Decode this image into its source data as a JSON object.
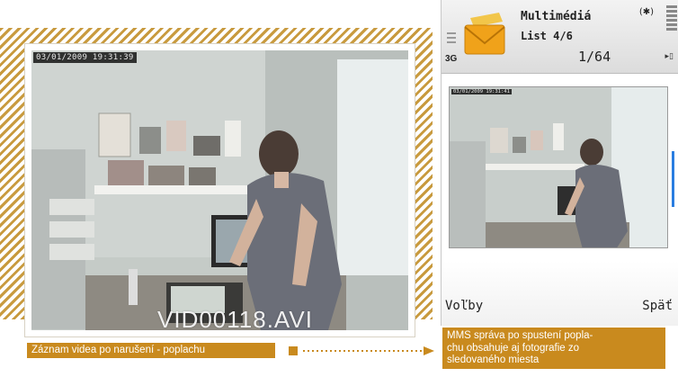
{
  "camera": {
    "timestamp": "03/01/2009 19:31:39",
    "filename": "VID00118.AVI"
  },
  "captions": {
    "left": "Záznam videa po narušení - poplachu",
    "right_line1": "MMS správa po spustení popla-",
    "right_line2": "chu obsahuje aj fotografie zo",
    "right_line3": "sledovaného miesta"
  },
  "phone": {
    "title": "Multimédiá",
    "subtitle": "List 4/6",
    "counter": "1/64",
    "network": "3G",
    "photo_timestamp": "03/01/2009 19:31:41",
    "softkey_left": "Voľby",
    "softkey_right": "Späť"
  },
  "colors": {
    "caption_bg": "#c98a1e",
    "hatch": "#c89a3e",
    "scrollbar": "#2a7de0"
  },
  "icons": [
    "envelope-icon",
    "menu-lines-icon",
    "signal-icon",
    "battery-icon",
    "nav-arrow-icon"
  ]
}
